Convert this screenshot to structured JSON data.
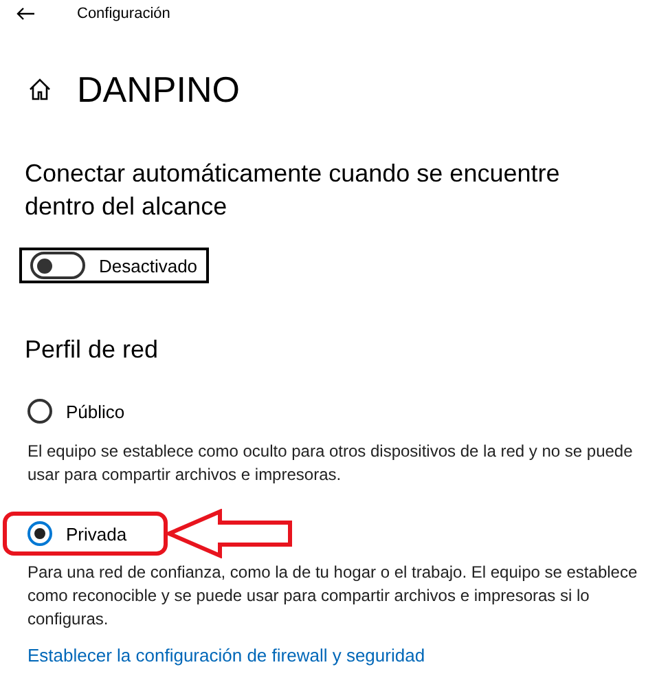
{
  "window": {
    "title": "Configuración"
  },
  "network_name": "DANPINO",
  "auto_connect": {
    "heading": "Conectar automáticamente cuando se encuentre dentro del alcance",
    "on": false,
    "focused": true,
    "state_label": "Desactivado"
  },
  "network_profile": {
    "heading": "Perfil de red",
    "options": [
      {
        "label": "Público",
        "selected": false,
        "highlighted": false,
        "description": "El equipo se establece como oculto para otros dispositivos de la red y no se puede usar para compartir archivos e impresoras."
      },
      {
        "label": "Privada",
        "selected": true,
        "highlighted": true,
        "description": "Para una red de confianza, como la de tu hogar o el trabajo. El equipo se establece como reconocible y se puede usar para compartir archivos e impresoras si lo configuras."
      }
    ]
  },
  "link": "Establecer la configuración de firewall y seguridad"
}
